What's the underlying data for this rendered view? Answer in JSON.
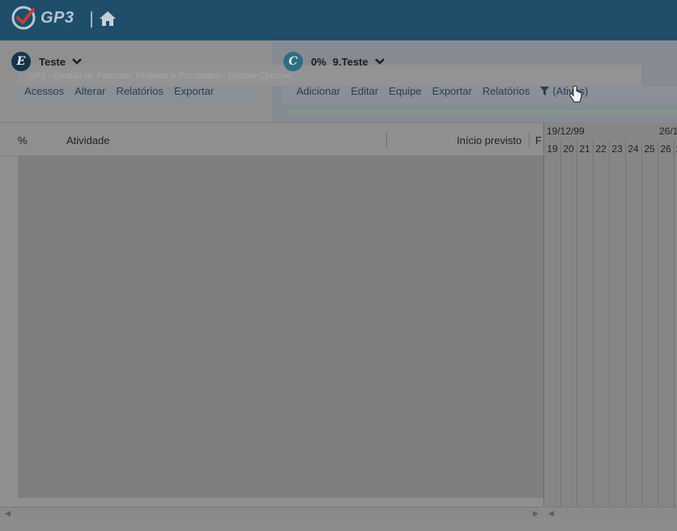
{
  "app": {
    "logo_text": "GP3"
  },
  "left_selector": {
    "badge": "E",
    "title": "Teste"
  },
  "right_selector": {
    "badge": "C",
    "percent": "0%",
    "title": "9.Teste"
  },
  "overlay_title": "GP3 - Gestão de Pessoas, Projetos e Processos - Google Chrome",
  "left_menu": [
    "Acessos",
    "Alterar",
    "Relatórios",
    "Exportar"
  ],
  "right_menu": [
    "Adicionar",
    "Editar",
    "Equipe",
    "Exportar",
    "Relatórios"
  ],
  "filter_label": "(Ativos)",
  "columns": {
    "pct": "%",
    "activity": "Atividade",
    "start": "Início previsto",
    "end": "F"
  },
  "gantt": {
    "weeks": [
      "19/12/99",
      "26/1"
    ],
    "days": [
      "19",
      "20",
      "21",
      "22",
      "23",
      "24",
      "25",
      "26",
      "2"
    ]
  },
  "colors": {
    "topbar": "#1e4e6a",
    "badge_e": "#16344a",
    "badge_c": "#2f6d83"
  },
  "icons": [
    "check-logo-icon",
    "home-icon",
    "chevron-down-icon",
    "filter-icon",
    "hand-cursor-icon"
  ]
}
